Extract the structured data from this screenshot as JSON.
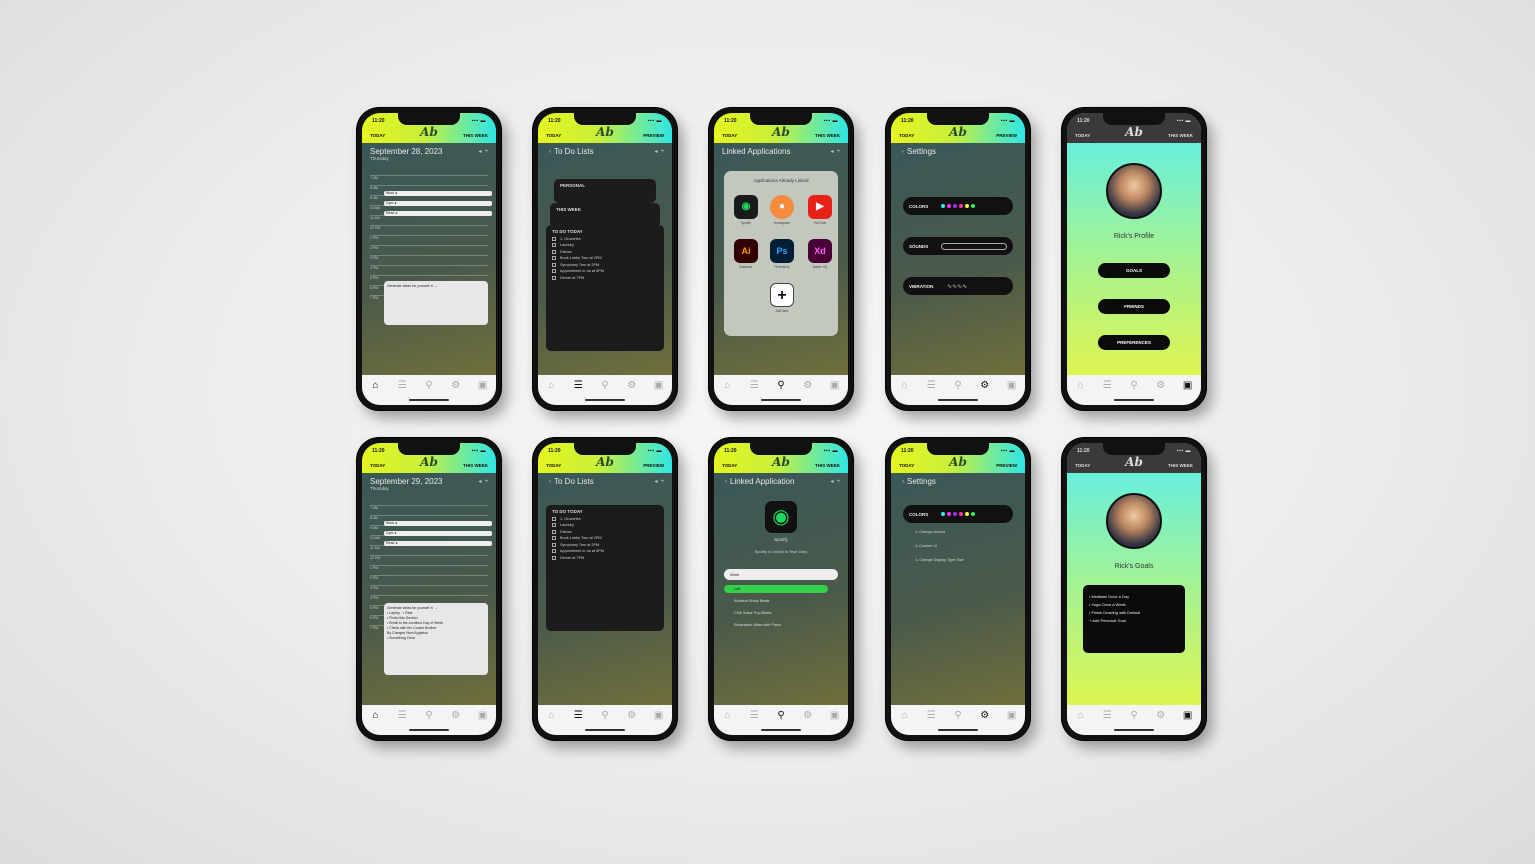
{
  "status": {
    "time": "11:20",
    "signal": "▪▪▪ ▬"
  },
  "topbar": {
    "left": "TODAY",
    "logo": "Ab",
    "right_a": "THIS WEEK",
    "right_b": "PREVIEW",
    "right_c": "THIS WEEK"
  },
  "nav_icons": [
    "⌂",
    "☰",
    "⚲",
    "⚙",
    "▣"
  ],
  "calendar": {
    "date_a": "September 28, 2023",
    "date_b": "September 29, 2023",
    "weekday": "Thursday",
    "times": [
      "7 AM",
      "8 AM",
      "9 AM",
      "10 AM",
      "11 AM",
      "12 PM",
      "1 PM",
      "2 PM",
      "3 PM",
      "4 PM",
      "5 PM",
      "6 PM",
      "7 PM"
    ],
    "events": [
      "Work ●",
      "Gym ●",
      "Read ●"
    ],
    "card_a": "Generate Ideas for yourself  ✕  →",
    "card_b_lines": [
      "Generate Ideas for yourself  ✕  →",
      "• Laptop · • Rest",
      "• Finish this Section",
      "• Email to the Architect Day of Week",
      "• Check with the Cousin Brother",
      "By Cheaper Next Appleton",
      "• Something Clear"
    ]
  },
  "todo": {
    "title": "To Do Lists",
    "tab_1": "PERSONAL",
    "tab_2": "THIS WEEK",
    "card_title": "TO DO TODAY",
    "items": [
      "1. Groceries",
      "Laundry",
      "Dishes",
      "Book Lobby Tour at 2PM",
      "Symphony Tom at 2PM",
      "Appointment to do at 5PM",
      "Dinner at 7PM"
    ]
  },
  "apps": {
    "title_a": "Linked Applications",
    "panel_header": "Applications Already Linked",
    "labels": [
      "Spotify",
      "Headspace",
      "YouTube",
      "Illustrator",
      "Photoshop",
      "Adobe XD",
      "Add New"
    ],
    "title_b": "Linked Application",
    "spotify_name": "Spotify",
    "spotify_sub": "Spotify is Linked to Rise Daily",
    "search_value": "Work",
    "playlist": [
      "Lofi",
      "Ambient Study Beats",
      "Chill Guitar Pop Beats",
      "Relaxation Vibes with Piano"
    ]
  },
  "settings": {
    "title": "Settings",
    "pills": [
      "COLORS",
      "SOUNDS",
      "VIBRATION"
    ],
    "links": [
      "Change Accent",
      "Custom UI",
      "Change Display Type Size"
    ]
  },
  "profile": {
    "name_a": "Rick's Profile",
    "name_b": "Rick's Goals",
    "buttons": [
      "GOALS",
      "FRIENDS",
      "PREFERENCES"
    ],
    "goals": [
      "• Meditate Once a Day",
      "• Yoga Once a Week",
      "• Finish Drawing with Default",
      "+ Add Personal Goal"
    ]
  }
}
